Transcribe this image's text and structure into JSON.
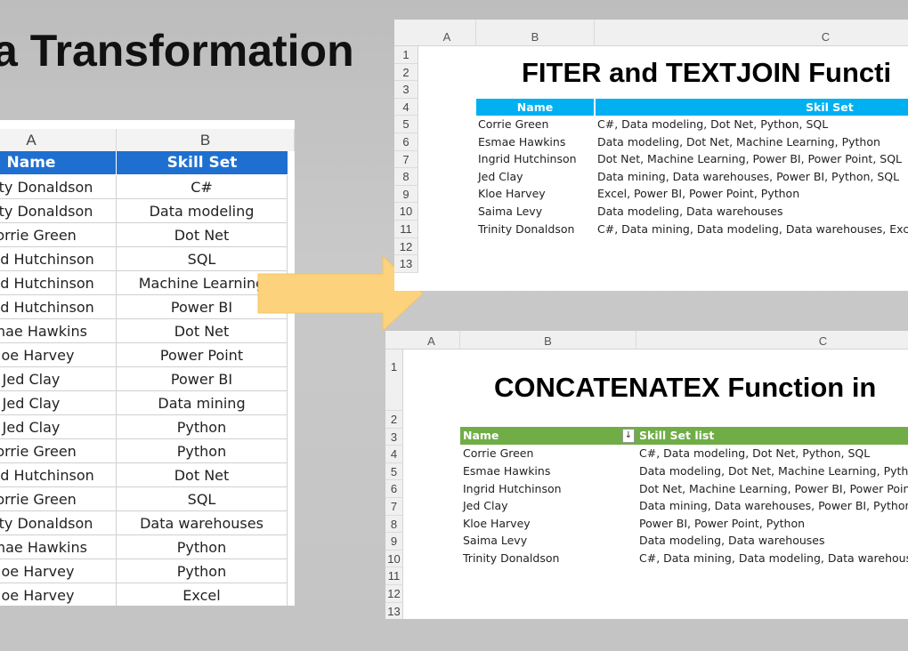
{
  "slide_title": "a Transformation",
  "left_table": {
    "columns": [
      "A",
      "B"
    ],
    "headers": {
      "name": "Name",
      "skill": "Skill Set"
    },
    "header_color": "#1f6fd0",
    "rows": [
      {
        "name": "Trinity Donaldson",
        "skill": "C#"
      },
      {
        "name": "Trinity Donaldson",
        "skill": "Data modeling"
      },
      {
        "name": "Corrie Green",
        "skill": "Dot Net"
      },
      {
        "name": "Ingrid Hutchinson",
        "skill": "SQL"
      },
      {
        "name": "Ingrid Hutchinson",
        "skill": "Machine Learning"
      },
      {
        "name": "Ingrid Hutchinson",
        "skill": "Power BI"
      },
      {
        "name": "Esmae Hawkins",
        "skill": "Dot Net"
      },
      {
        "name": "Kloe Harvey",
        "skill": "Power Point"
      },
      {
        "name": "Jed Clay",
        "skill": "Power BI"
      },
      {
        "name": "Jed Clay",
        "skill": "Data mining"
      },
      {
        "name": "Jed Clay",
        "skill": "Python"
      },
      {
        "name": "Corrie Green",
        "skill": "Python"
      },
      {
        "name": "Ingrid Hutchinson",
        "skill": "Dot Net"
      },
      {
        "name": "Corrie Green",
        "skill": "SQL"
      },
      {
        "name": "Trinity Donaldson",
        "skill": "Data warehouses"
      },
      {
        "name": "Esmae Hawkins",
        "skill": "Python"
      },
      {
        "name": "Kloe Harvey",
        "skill": "Python"
      },
      {
        "name": "Kloe Harvey",
        "skill": "Excel"
      }
    ]
  },
  "arrow_color": "#fdd27c",
  "top_sheet": {
    "columns": [
      "A",
      "B",
      "C"
    ],
    "row_numbers": [
      "1",
      "2",
      "3",
      "4",
      "5",
      "6",
      "7",
      "8",
      "9",
      "10",
      "11",
      "12",
      "13"
    ],
    "title": "FITER and TEXTJOIN Functi",
    "headers": {
      "name": "Name",
      "skill": "Skil Set"
    },
    "header_color": "#00b0f0",
    "rows": [
      {
        "name": "Corrie Green",
        "skills": "C#, Data modeling, Dot Net, Python, SQL"
      },
      {
        "name": "Esmae Hawkins",
        "skills": "Data modeling, Dot Net, Machine Learning, Python"
      },
      {
        "name": "Ingrid Hutchinson",
        "skills": "Dot Net, Machine Learning, Power BI, Power Point, SQL"
      },
      {
        "name": "Jed Clay",
        "skills": "Data mining, Data warehouses, Power BI, Python, SQL"
      },
      {
        "name": "Kloe Harvey",
        "skills": "Excel, Power BI, Power Point, Python"
      },
      {
        "name": "Saima Levy",
        "skills": "Data modeling, Data warehouses"
      },
      {
        "name": "Trinity Donaldson",
        "skills": "C#, Data mining, Data modeling, Data warehouses, Excel, Pow"
      }
    ]
  },
  "bottom_sheet": {
    "columns": [
      "A",
      "B",
      "C"
    ],
    "row_numbers": [
      "1",
      "2",
      "3",
      "4",
      "5",
      "6",
      "7",
      "8",
      "9",
      "10",
      "11",
      "12",
      "13"
    ],
    "title": "CONCATENATEX Function in",
    "headers": {
      "name": "Name",
      "skill": "Skill Set list"
    },
    "header_color": "#70ad47",
    "rows": [
      {
        "name": "Corrie Green",
        "skills": "C#, Data modeling, Dot Net, Python, SQL"
      },
      {
        "name": "Esmae Hawkins",
        "skills": "Data modeling, Dot Net, Machine Learning, Python"
      },
      {
        "name": "Ingrid Hutchinson",
        "skills": "Dot Net, Machine Learning, Power BI, Power Point, SQL"
      },
      {
        "name": "Jed Clay",
        "skills": "Data mining, Data warehouses, Power BI, Python, SQL"
      },
      {
        "name": "Kloe Harvey",
        "skills": "Power BI, Power Point, Python"
      },
      {
        "name": "Saima Levy",
        "skills": "Data modeling, Data warehouses"
      },
      {
        "name": "Trinity Donaldson",
        "skills": "C#, Data mining, Data modeling, Data warehouses, Ex"
      }
    ]
  }
}
